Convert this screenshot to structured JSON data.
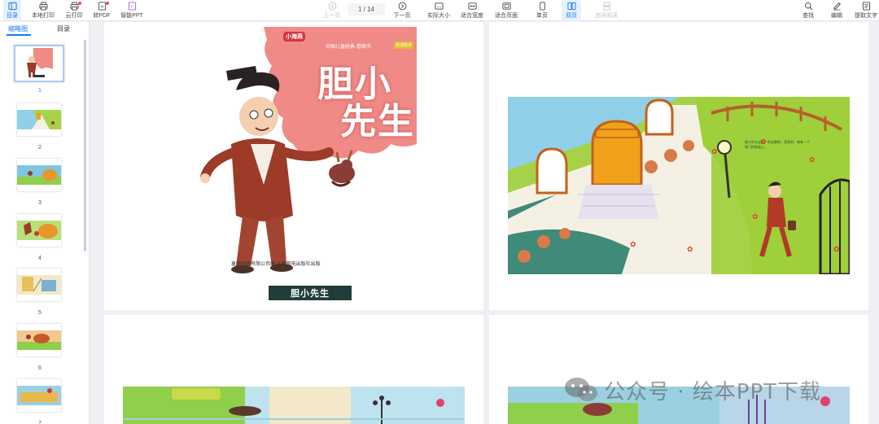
{
  "toolbar": {
    "left": [
      {
        "label": "目录",
        "icon": "toc-icon"
      },
      {
        "label": "本地打印",
        "icon": "printer-icon"
      },
      {
        "label": "云打印",
        "icon": "cloud-printer-icon"
      },
      {
        "label": "转PDF",
        "icon": "pdf-convert-icon"
      },
      {
        "label": "智能PPT",
        "icon": "smart-ppt-icon"
      }
    ],
    "prev_label": "上一页",
    "page_indicator": "1 / 14",
    "next_label": "下一页",
    "view": [
      {
        "label": "实际大小",
        "icon": "actual-size-icon"
      },
      {
        "label": "适合宽度",
        "icon": "fit-width-icon"
      },
      {
        "label": "适合页面",
        "icon": "fit-page-icon"
      },
      {
        "label": "单页",
        "icon": "single-page-icon"
      },
      {
        "label": "双页",
        "icon": "double-page-icon"
      },
      {
        "label": "连续阅读",
        "icon": "continuous-read-icon"
      }
    ],
    "right": [
      {
        "label": "查找",
        "icon": "search-icon"
      },
      {
        "label": "编辑",
        "icon": "edit-icon"
      },
      {
        "label": "提取文字",
        "icon": "extract-text-icon"
      }
    ]
  },
  "sidebar": {
    "tabs": [
      "缩略图",
      "目录"
    ],
    "thumbnails": [
      "1",
      "2",
      "3",
      "4",
      "5",
      "6",
      "7"
    ]
  },
  "cover": {
    "logo": "小海燕",
    "series": "中国儿童经典·看图书",
    "series_tag": "讲述版本",
    "title_line1": "胆小",
    "title_line2": "先生",
    "publisher": "童趣出版有限公司编  人民邮电出版社出版",
    "band_title": "胆小先生"
  },
  "story_text": "胆小先生走在一条安静的、漂亮的、带有一个铁门的街道上。",
  "watermark": "公众号 · 绘本PPT下载",
  "colors": {
    "accent": "#1677ff",
    "cover_pink": "#ef8a86",
    "cover_band": "#213c3b",
    "grass": "#9fcf3a",
    "door": "#f0a11c"
  }
}
